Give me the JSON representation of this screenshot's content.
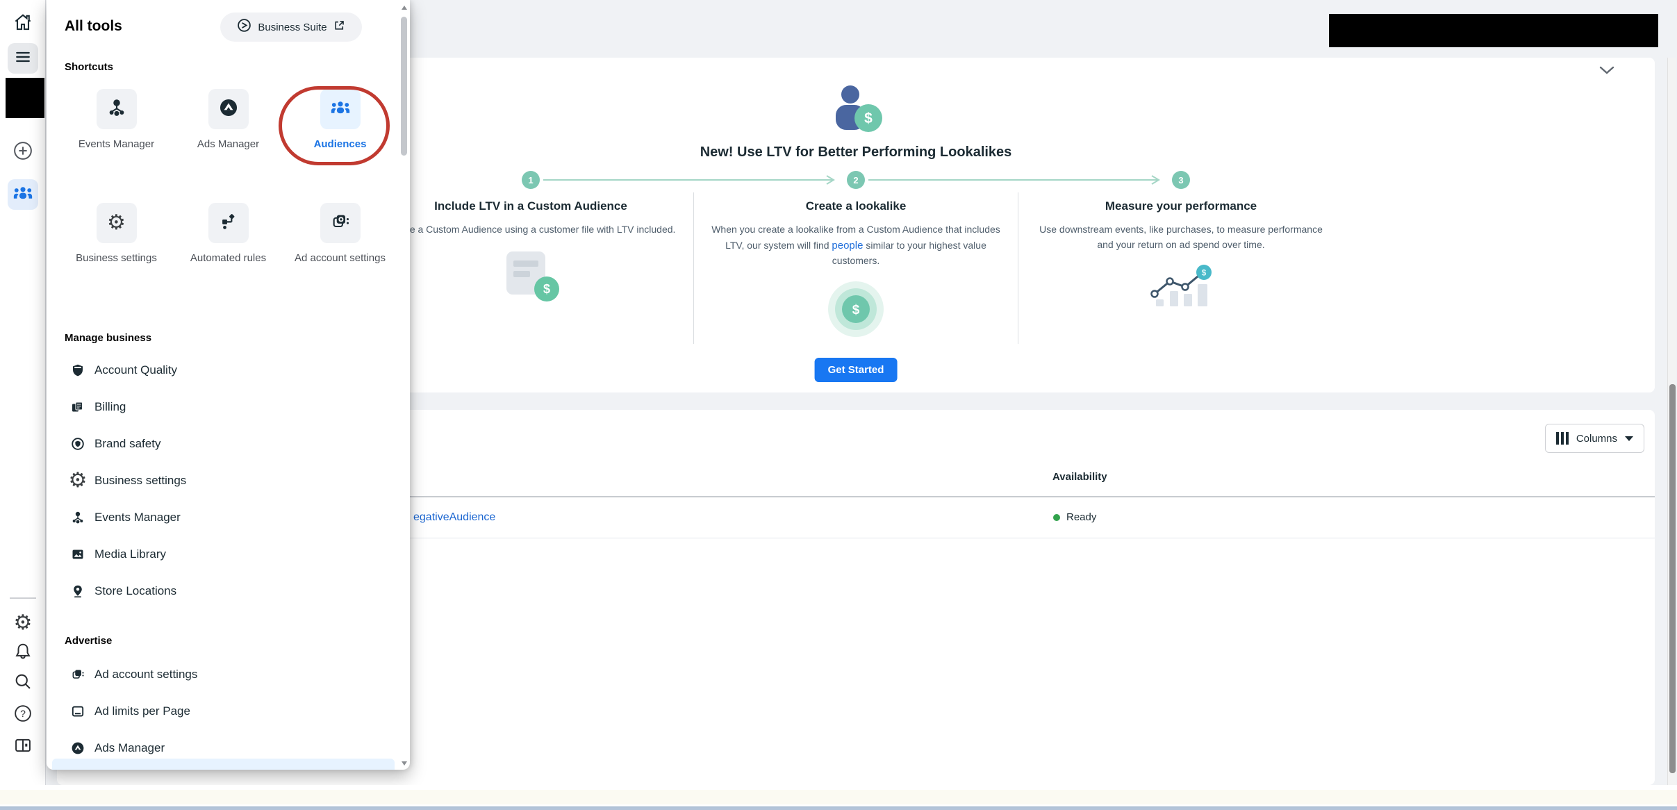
{
  "flyout": {
    "title": "All tools",
    "business_suite": {
      "label": "Business Suite"
    },
    "shortcuts": {
      "heading": "Shortcuts",
      "tiles": [
        {
          "label": "Events Manager"
        },
        {
          "label": "Ads Manager"
        },
        {
          "label": "Audiences"
        },
        {
          "label": "Business settings"
        },
        {
          "label": "Automated rules"
        },
        {
          "label": "Ad account settings"
        }
      ]
    },
    "manage_business": {
      "heading": "Manage business",
      "items": [
        {
          "label": "Account Quality"
        },
        {
          "label": "Billing"
        },
        {
          "label": "Brand safety"
        },
        {
          "label": "Business settings"
        },
        {
          "label": "Events Manager"
        },
        {
          "label": "Media Library"
        },
        {
          "label": "Store Locations"
        }
      ]
    },
    "advertise": {
      "heading": "Advertise",
      "items": [
        {
          "label": "Ad account settings"
        },
        {
          "label": "Ad limits per Page"
        },
        {
          "label": "Ads Manager"
        }
      ]
    }
  },
  "banner": {
    "title": "New! Use LTV for Better Performing Lookalikes",
    "steps": [
      {
        "number": "1",
        "heading": "Include LTV in a Custom Audience",
        "body": "Create a Custom Audience using a customer file with LTV included."
      },
      {
        "number": "2",
        "heading": "Create a lookalike",
        "body_before": "When you create a lookalike from a Custom Audience that includes LTV, our system will find ",
        "link": "people",
        "body_after": " similar to your highest value customers."
      },
      {
        "number": "3",
        "heading": "Measure your performance",
        "body": "Use downstream events, like purchases, to measure performance and your return on ad spend over time."
      }
    ],
    "cta_label": "Get Started"
  },
  "table": {
    "columns_button": "Columns",
    "availability_header": "Availability",
    "rows": [
      {
        "name": "egativeAudience",
        "availability": "Ready"
      }
    ]
  },
  "icons": {
    "dollar": "$",
    "question": "?"
  },
  "colors": {
    "accent_blue": "#1877f2",
    "link_blue": "#216fdb",
    "mint_green": "#6fc7ac",
    "ready_green": "#31a24c",
    "annotation_red": "#c13a30"
  }
}
